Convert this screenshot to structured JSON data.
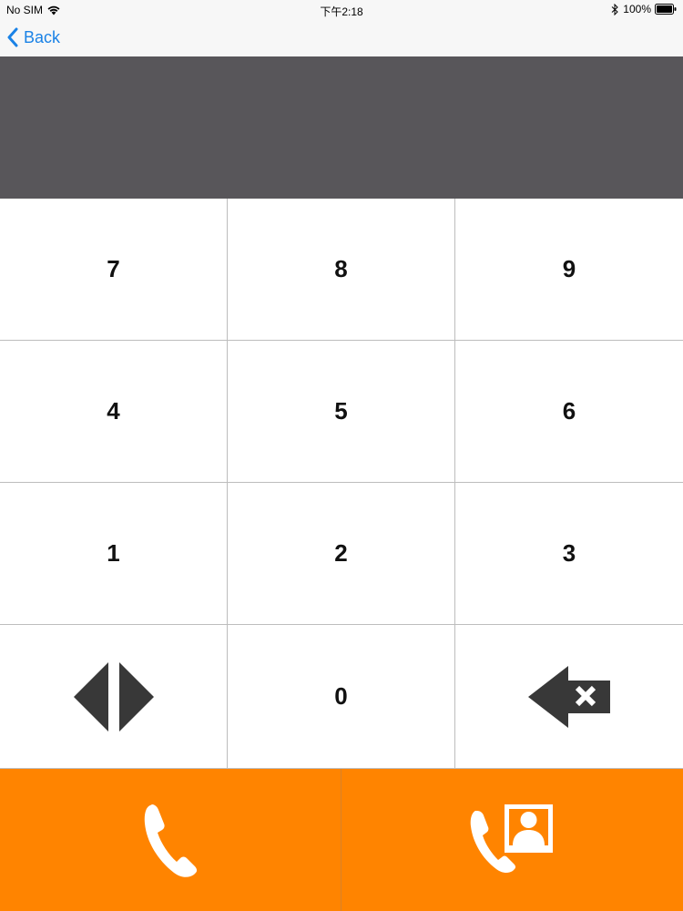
{
  "status_bar": {
    "carrier": "No SIM",
    "time": "下午2:18",
    "battery": "100%"
  },
  "nav": {
    "back_label": "Back"
  },
  "display": {
    "number": ""
  },
  "keypad": {
    "keys": [
      "7",
      "8",
      "9",
      "4",
      "5",
      "6",
      "1",
      "2",
      "3"
    ],
    "zero": "0"
  },
  "icons": {
    "toggle": "toggle-arrows-icon",
    "backspace": "backspace-icon",
    "call": "phone-icon",
    "video_call": "video-call-icon"
  },
  "colors": {
    "accent_orange": "#ff8400",
    "display_bg": "#58565a",
    "link_blue": "#1a82e6",
    "icon_dark": "#383838"
  }
}
